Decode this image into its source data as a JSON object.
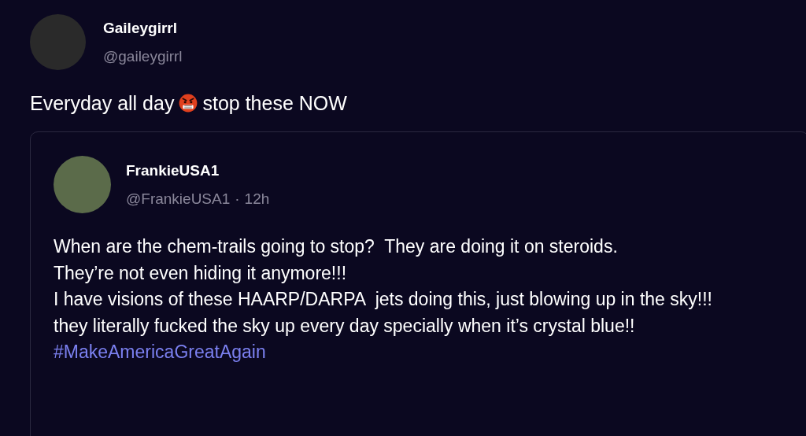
{
  "post": {
    "name": "Gaileygirrl",
    "handle": "@gaileygirrl",
    "text_before": "Everyday all day",
    "text_after": "stop these NOW"
  },
  "quote": {
    "name": "FrankieUSA1",
    "handle": "@FrankieUSA1",
    "separator": "·",
    "time": "12h",
    "lines": [
      "When are the chem-trails going to stop?  They are doing it on steroids.",
      "They’re not even hiding it anymore!!!",
      "I have visions of these HAARP/DARPA  jets doing this, just blowing up in the sky!!!",
      "they literally fucked the sky up every day specially when it’s crystal blue!!"
    ],
    "hashtag": "#MakeAmericaGreatAgain"
  }
}
